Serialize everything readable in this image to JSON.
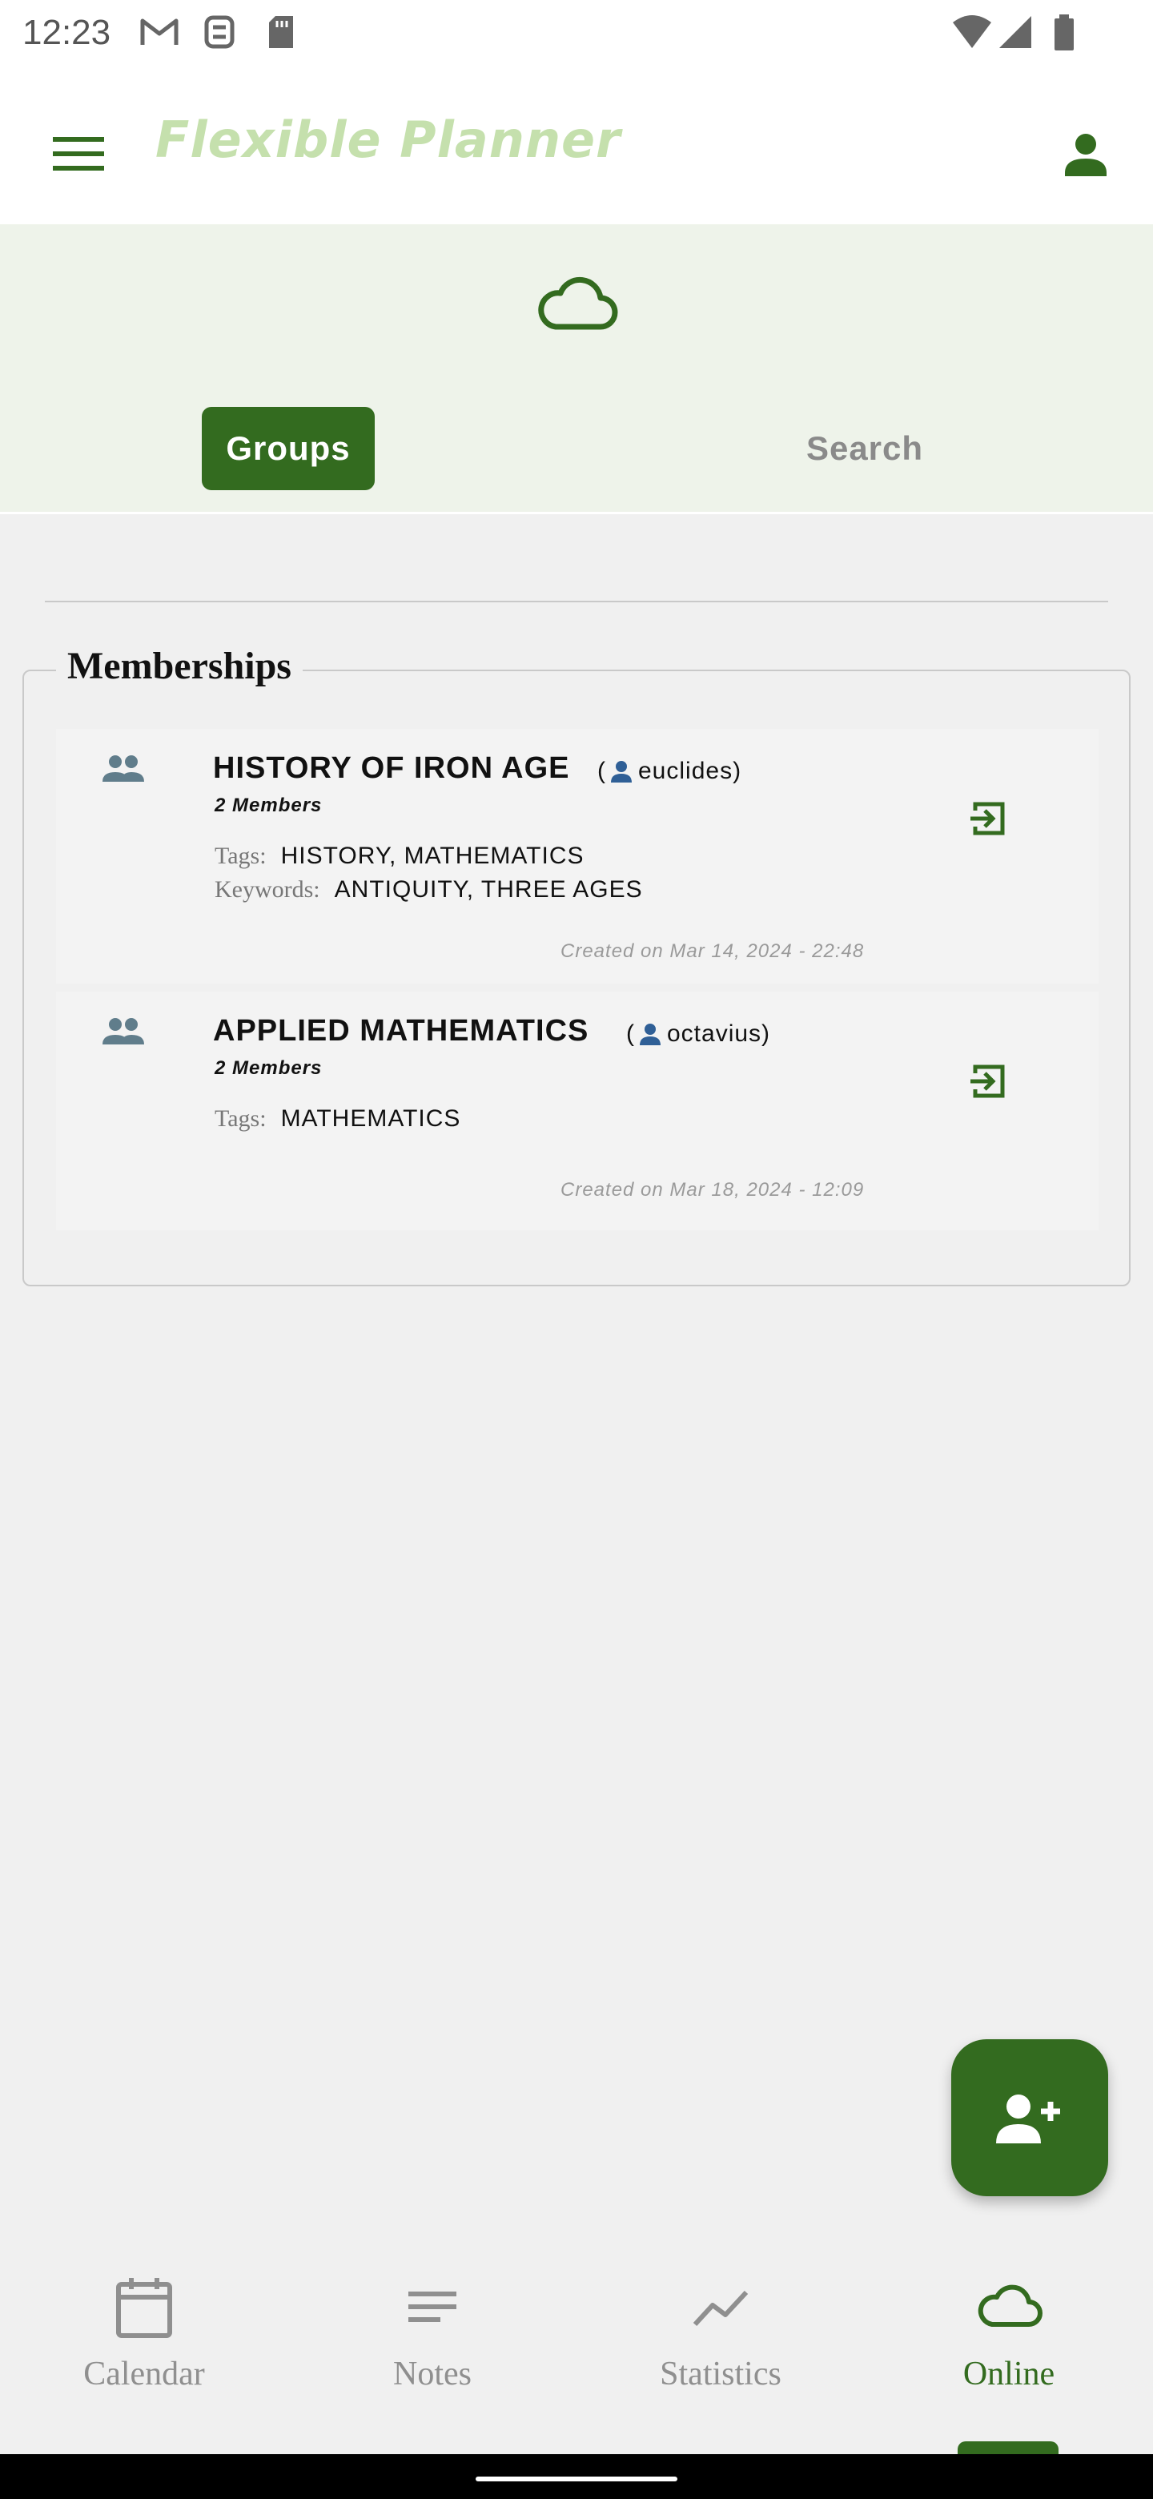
{
  "status_bar": {
    "time": "12:23",
    "icons": [
      "gmail-icon",
      "sim-toolkit-icon",
      "sd-card-icon",
      "wifi-icon",
      "signal-icon",
      "battery-icon"
    ]
  },
  "app_bar": {
    "title": "Flexible Planner",
    "menu_icon": "hamburger-menu-icon",
    "account_icon": "person-icon"
  },
  "online_header": {
    "hero_icon": "cloud-icon",
    "tabs": [
      {
        "label": "Groups",
        "active": true
      },
      {
        "label": "Search",
        "active": false
      }
    ]
  },
  "memberships": {
    "legend": "Memberships",
    "groups": [
      {
        "name": "HISTORY OF IRON AGE",
        "owner_open": "(",
        "owner": "euclides)",
        "members": "2 Members",
        "tags_label": "Tags:",
        "tags": "HISTORY, MATHEMATICS",
        "keywords_label": "Keywords:",
        "keywords": "ANTIQUITY, THREE AGES",
        "created": "Created on Mar 14, 2024 - 22:48"
      },
      {
        "name": "APPLIED MATHEMATICS",
        "owner_open": "(",
        "owner": "octavius)",
        "members": "2 Members",
        "tags_label": "Tags:",
        "tags": "MATHEMATICS",
        "created": "Created on Mar 18, 2024 - 12:09"
      }
    ]
  },
  "fab": {
    "icon": "add-person-icon"
  },
  "bottom_nav": {
    "items": [
      {
        "label": "Calendar",
        "icon": "calendar-icon"
      },
      {
        "label": "Notes",
        "icon": "notes-icon"
      },
      {
        "label": "Statistics",
        "icon": "statistics-icon"
      },
      {
        "label": "Online",
        "icon": "cloud-icon",
        "active": true
      }
    ]
  },
  "colors": {
    "primary": "#336b1f",
    "title_tint": "#c5e0ad",
    "header_bg": "#eef3ea",
    "page_bg": "#f0f0f0",
    "group_icon": "#607d8b"
  }
}
